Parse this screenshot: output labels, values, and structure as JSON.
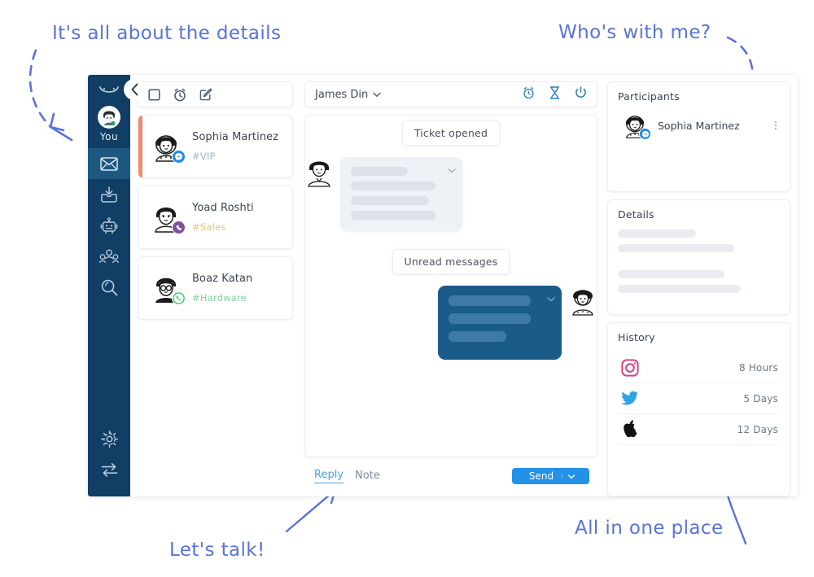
{
  "annotations": [
    {
      "text": "It's all about the details",
      "name": "annotation-details"
    },
    {
      "text": "Who's with me?",
      "name": "annotation-participants"
    },
    {
      "text": "Let's talk!",
      "name": "annotation-reply"
    },
    {
      "text": "All in one place",
      "name": "annotation-history"
    }
  ],
  "colors": {
    "rail_bg": "#103e64",
    "rail_active": "#1c587f",
    "accent_orange": "#ef8a6a",
    "bubble_out": "#1b5b8a",
    "bubble_in": "#eef1f5",
    "send_blue": "#2391e8",
    "annotation_blue": "#5a72d8",
    "tag_vip": "#9fb3c8",
    "tag_sales": "#e0c860",
    "tag_hardware": "#86cf9a"
  },
  "rail": {
    "logo_icon": "smile-logo-icon",
    "avatar_label": "You",
    "collapse_icon": "chevron-left-icon",
    "items": [
      {
        "icon": "envelope-icon",
        "name": "rail-item-inbox",
        "active": true
      },
      {
        "icon": "archive-download-icon",
        "name": "rail-item-archive",
        "active": false
      },
      {
        "icon": "robot-icon",
        "name": "rail-item-bots",
        "active": false
      },
      {
        "icon": "team-icon",
        "name": "rail-item-team",
        "active": false
      },
      {
        "icon": "search-icon",
        "name": "rail-item-search",
        "active": false
      }
    ],
    "bottom_items": [
      {
        "icon": "gear-icon",
        "name": "rail-item-settings"
      },
      {
        "icon": "transfer-icon",
        "name": "rail-item-transfer"
      }
    ]
  },
  "list": {
    "toolbar": [
      {
        "icon": "checkbox-icon",
        "name": "select-all-button"
      },
      {
        "icon": "alarm-clock-icon",
        "name": "snooze-button"
      },
      {
        "icon": "compose-icon",
        "name": "compose-button"
      }
    ],
    "conversations": [
      {
        "name": "Sophia Martinez",
        "tag": "#VIP",
        "tag_class": "tag-vip",
        "channel": "messenger",
        "active": true
      },
      {
        "name": "Yoad Roshti",
        "tag": "#Sales",
        "tag_class": "tag-sales",
        "channel": "viber",
        "active": false
      },
      {
        "name": "Boaz Katan",
        "tag": "#Hardware",
        "tag_class": "tag-hardware",
        "channel": "whatsapp",
        "active": false
      }
    ]
  },
  "chat": {
    "title": "James Din",
    "title_caret": "chevron-down-icon",
    "header_icons": [
      {
        "icon": "alarm-clock-icon",
        "name": "snooze-conversation-button"
      },
      {
        "icon": "hourglass-icon",
        "name": "pending-button"
      },
      {
        "icon": "power-icon",
        "name": "close-conversation-button"
      }
    ],
    "divider_ticket": "Ticket opened",
    "divider_unread": "Unread messages",
    "incoming_lines": [
      62,
      92,
      85,
      92
    ],
    "outgoing_lines": [
      88,
      88,
      62
    ],
    "footer": {
      "tabs": [
        {
          "label": "Reply",
          "active": true
        },
        {
          "label": "Note",
          "active": false
        }
      ],
      "send_label": "Send",
      "send_caret": "caret-down-icon"
    }
  },
  "side": {
    "participants": {
      "title": "Participants",
      "people": [
        {
          "name": "Sophia Martinez",
          "channel": "messenger",
          "menu_icon": "kebab-menu-icon"
        }
      ]
    },
    "details": {
      "title": "Details",
      "skeletons": [
        48,
        72,
        66,
        76
      ]
    },
    "history": {
      "title": "History",
      "rows": [
        {
          "icon": "instagram-icon",
          "time": "8 Hours"
        },
        {
          "icon": "twitter-icon",
          "time": "5 Days"
        },
        {
          "icon": "apple-icon",
          "time": "12 Days"
        }
      ]
    }
  }
}
